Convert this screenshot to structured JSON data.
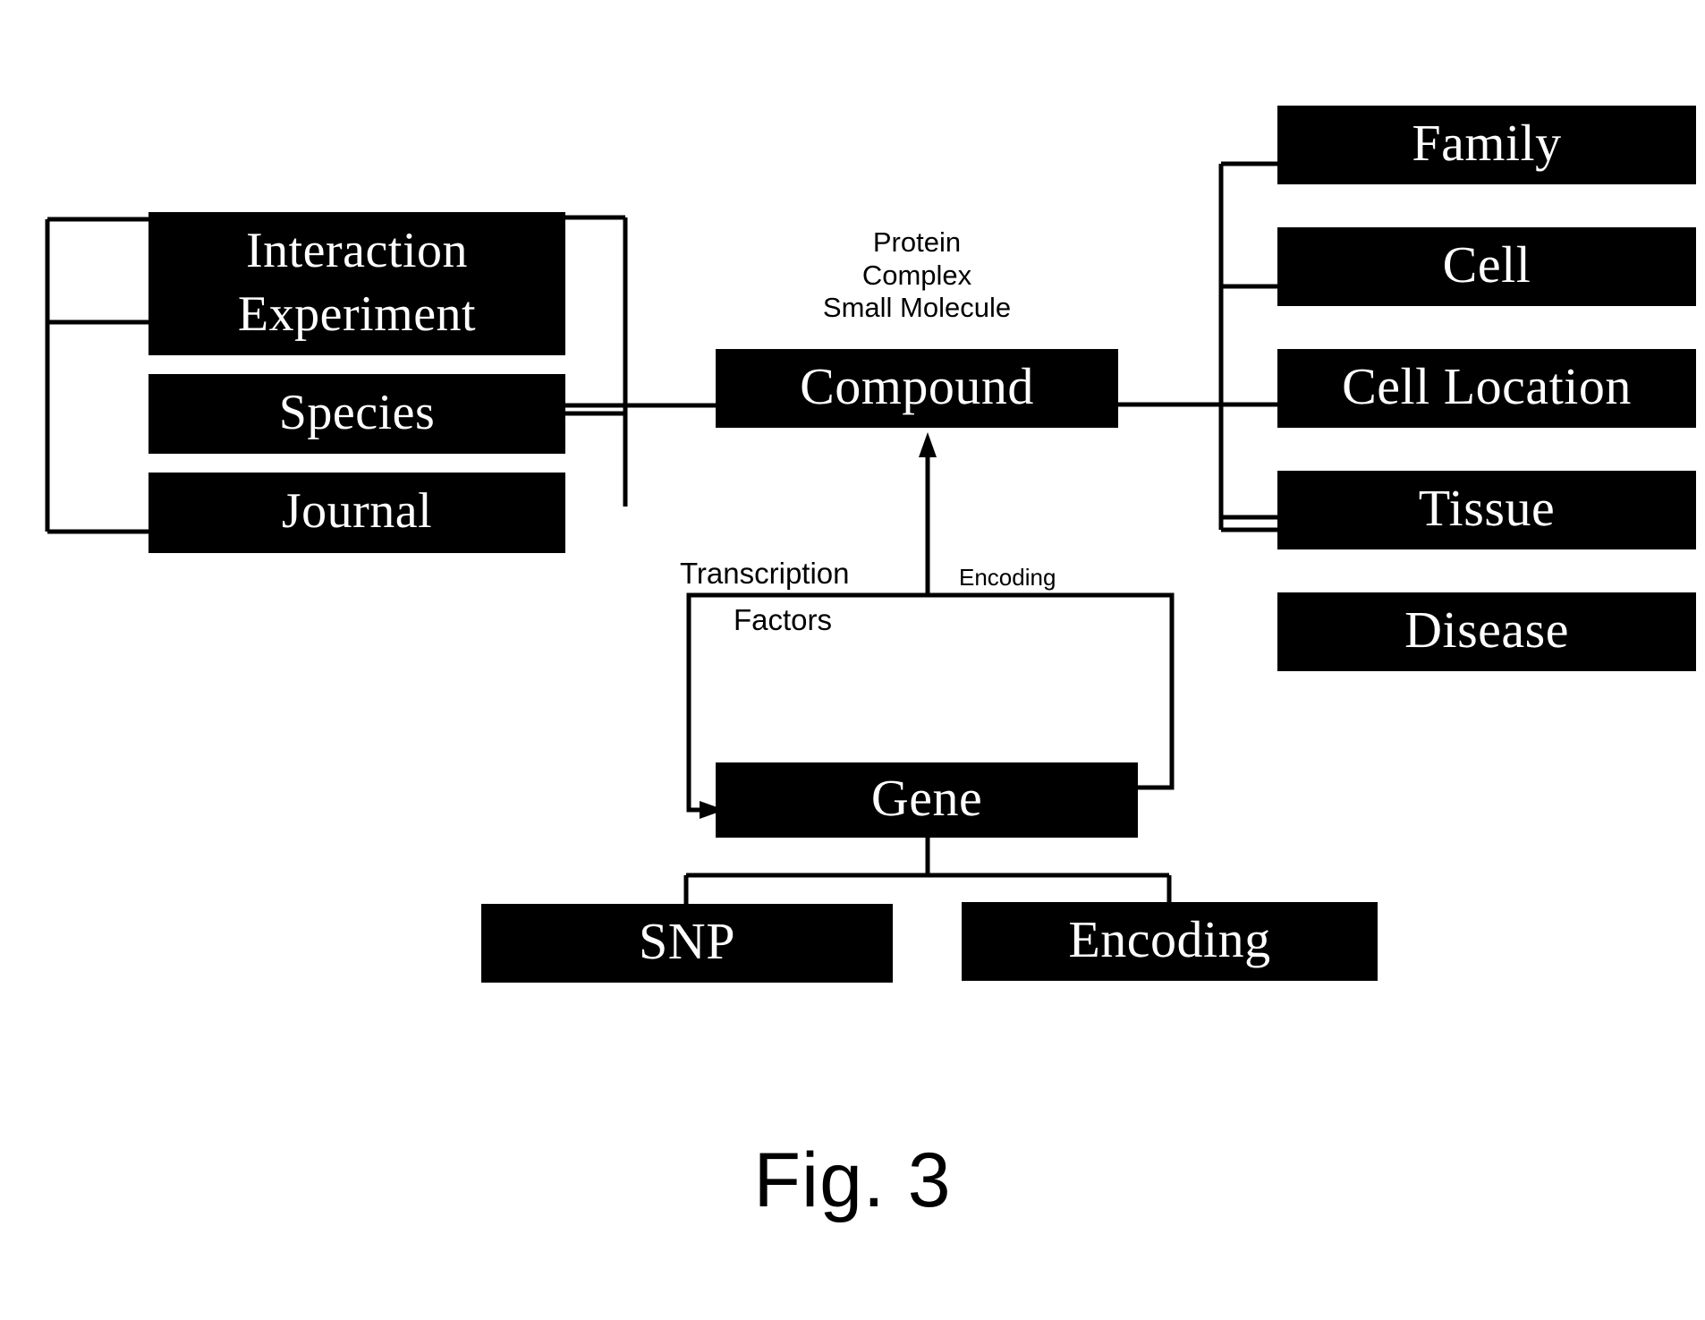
{
  "figure": {
    "caption": "Fig. 3",
    "background_color": "#ffffff",
    "node_fill_color": "#000000",
    "node_text_color": "#ffffff",
    "line_color": "#000000"
  },
  "left_column": {
    "nodes": [
      {
        "id": "interaction",
        "label": "Interaction"
      },
      {
        "id": "experiment",
        "label": "Experiment"
      },
      {
        "id": "species",
        "label": "Species"
      },
      {
        "id": "journal",
        "label": "Journal"
      }
    ]
  },
  "center": {
    "compound": {
      "id": "compound",
      "label": "Compound"
    },
    "compound_types": "Protein\nComplex\nSmall Molecule",
    "compound_types_lines": [
      "Protein",
      "Complex",
      "Small Molecule"
    ],
    "gene": {
      "id": "gene",
      "label": "Gene"
    },
    "edge_labels": {
      "transcription_factors_line1": "Transcription",
      "transcription_factors_line2": "Factors",
      "encoding": "Encoding"
    },
    "children": [
      {
        "id": "snp",
        "label": "SNP"
      },
      {
        "id": "encoding",
        "label": "Encoding"
      }
    ]
  },
  "right_column": {
    "nodes": [
      {
        "id": "family",
        "label": "Family"
      },
      {
        "id": "cell",
        "label": "Cell"
      },
      {
        "id": "cell-location",
        "label": "Cell Location"
      },
      {
        "id": "tissue",
        "label": "Tissue"
      },
      {
        "id": "disease",
        "label": "Disease"
      }
    ]
  }
}
